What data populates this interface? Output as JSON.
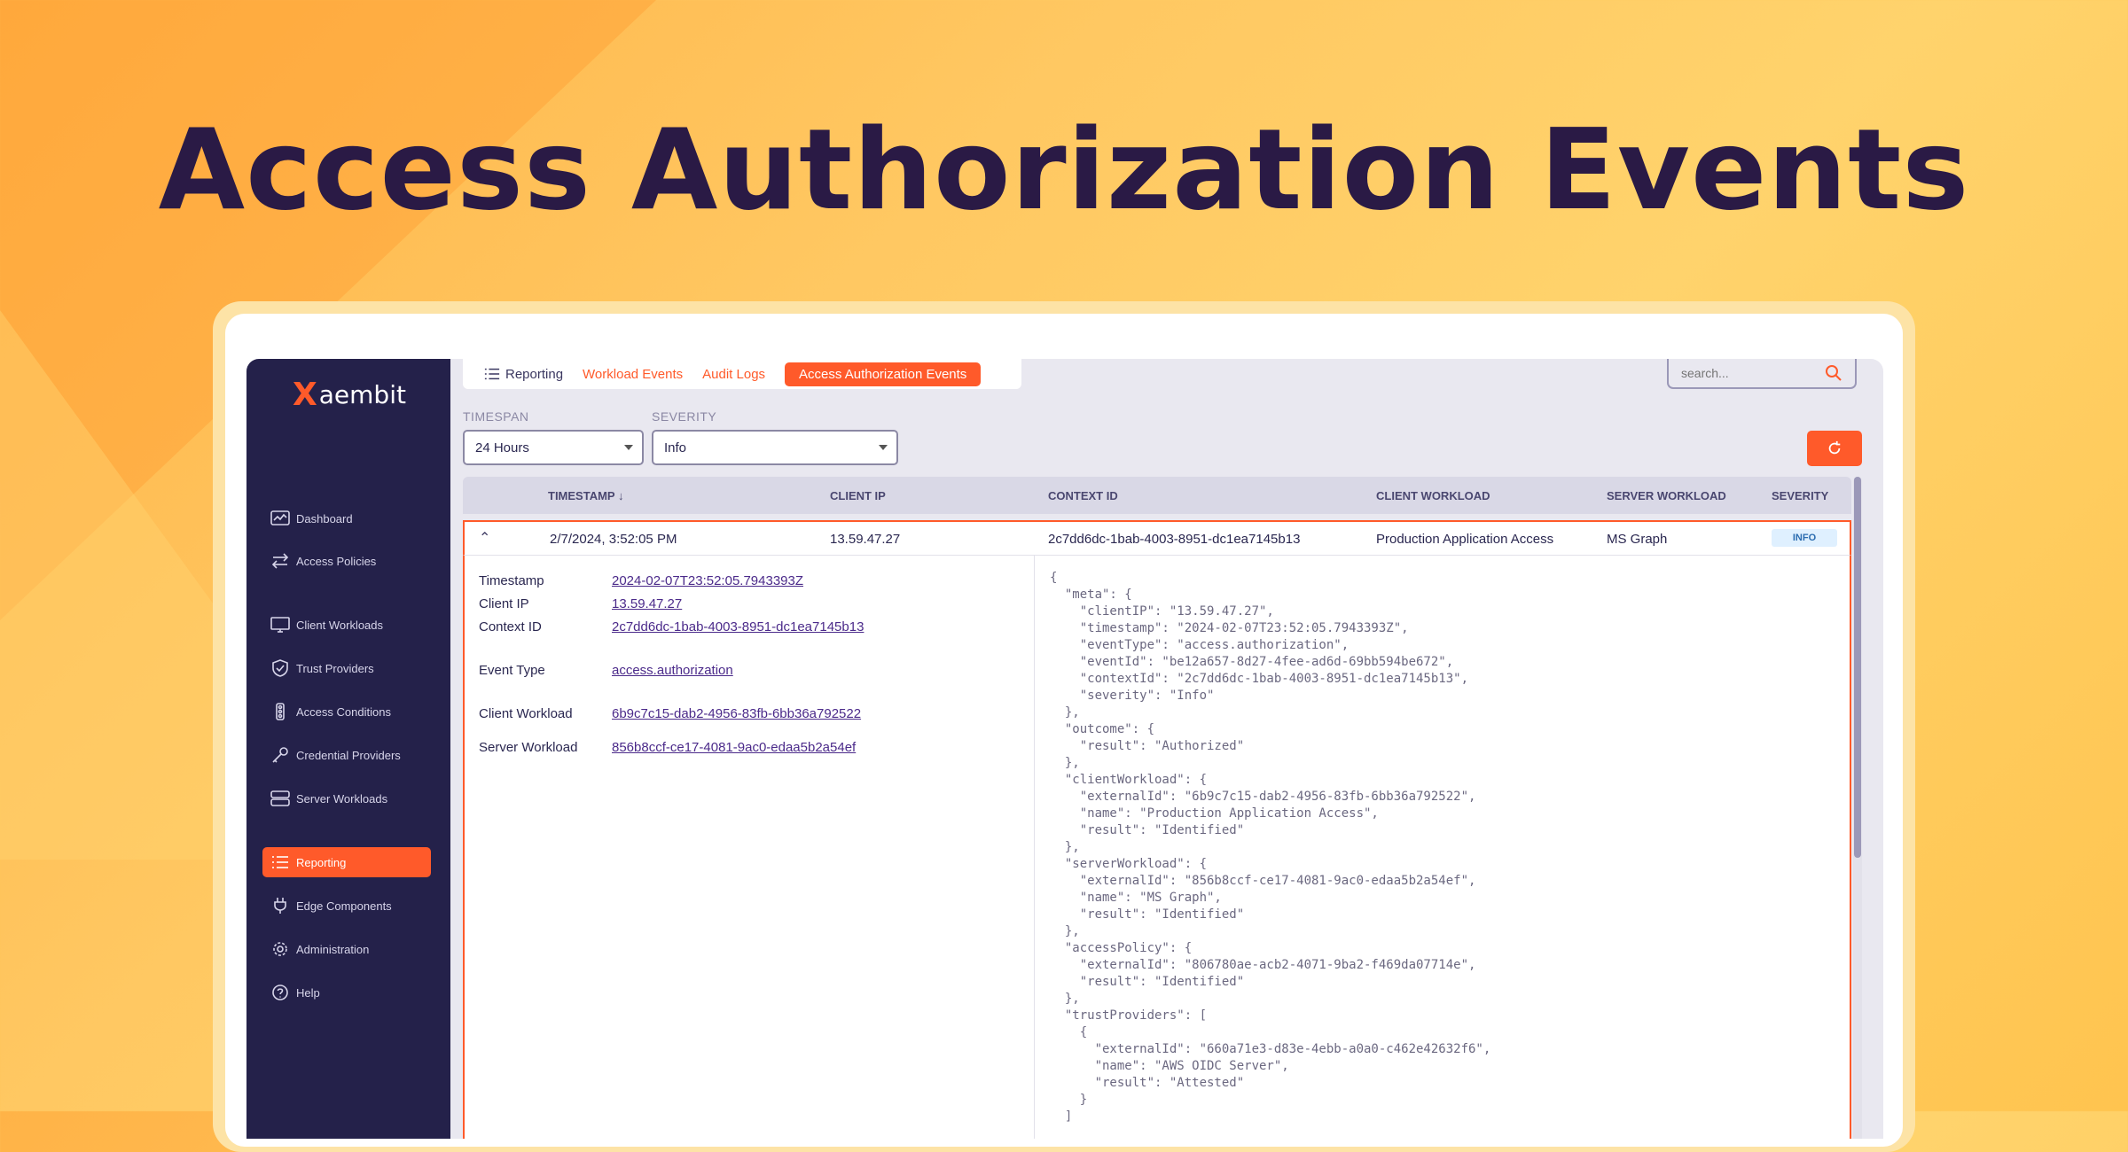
{
  "headline": "Access Authorization Events",
  "brand": {
    "mark": "X",
    "name": "aembit",
    "accent": "#ff5a2a",
    "sidebar_bg": "#24214a"
  },
  "sidebar": {
    "items": [
      {
        "label": "Dashboard",
        "icon": "dashboard-icon"
      },
      {
        "label": "Access Policies",
        "icon": "arrows-exchange-icon"
      },
      {
        "label": "Client Workloads",
        "icon": "monitor-icon"
      },
      {
        "label": "Trust Providers",
        "icon": "shield-check-icon"
      },
      {
        "label": "Access Conditions",
        "icon": "traffic-light-icon"
      },
      {
        "label": "Credential Providers",
        "icon": "key-icon"
      },
      {
        "label": "Server Workloads",
        "icon": "server-icon"
      },
      {
        "label": "Reporting",
        "icon": "list-icon",
        "active": true
      },
      {
        "label": "Edge Components",
        "icon": "plug-icon"
      },
      {
        "label": "Administration",
        "icon": "gear-icon"
      },
      {
        "label": "Help",
        "icon": "help-circle-icon"
      }
    ]
  },
  "tabs": {
    "crumb": "Reporting",
    "items": [
      "Workload Events",
      "Audit Logs",
      "Access Authorization Events"
    ],
    "active": "Access Authorization Events"
  },
  "search": {
    "placeholder": "search..."
  },
  "filters": {
    "timespan": {
      "label": "TIMESPAN",
      "value": "24 Hours"
    },
    "severity": {
      "label": "SEVERITY",
      "value": "Info"
    }
  },
  "table": {
    "columns": [
      "TIMESTAMP",
      "CLIENT IP",
      "CONTEXT ID",
      "CLIENT WORKLOAD",
      "SERVER WORKLOAD",
      "SEVERITY"
    ],
    "sort_indicator": "↓",
    "row": {
      "timestamp": "2/7/2024, 3:52:05 PM",
      "client_ip": "13.59.47.27",
      "context_id": "2c7dd6dc-1bab-4003-8951-dc1ea7145b13",
      "client_workload": "Production Application Access",
      "server_workload": "MS Graph",
      "severity": "INFO"
    }
  },
  "details": {
    "timestamp": {
      "label": "Timestamp",
      "value": "2024-02-07T23:52:05.7943393Z"
    },
    "client_ip": {
      "label": "Client IP",
      "value": "13.59.47.27"
    },
    "context_id": {
      "label": "Context ID",
      "value": "2c7dd6dc-1bab-4003-8951-dc1ea7145b13"
    },
    "event_type": {
      "label": "Event Type",
      "value": "access.authorization"
    },
    "client_workload": {
      "label": "Client Workload",
      "value": "6b9c7c15-dab2-4956-83fb-6bb36a792522"
    },
    "server_workload": {
      "label": "Server Workload",
      "value": "856b8ccf-ce17-4081-9ac0-edaa5b2a54ef"
    }
  },
  "json_text": "{\n  \"meta\": {\n    \"clientIP\": \"13.59.47.27\",\n    \"timestamp\": \"2024-02-07T23:52:05.7943393Z\",\n    \"eventType\": \"access.authorization\",\n    \"eventId\": \"be12a657-8d27-4fee-ad6d-69bb594be672\",\n    \"contextId\": \"2c7dd6dc-1bab-4003-8951-dc1ea7145b13\",\n    \"severity\": \"Info\"\n  },\n  \"outcome\": {\n    \"result\": \"Authorized\"\n  },\n  \"clientWorkload\": {\n    \"externalId\": \"6b9c7c15-dab2-4956-83fb-6bb36a792522\",\n    \"name\": \"Production Application Access\",\n    \"result\": \"Identified\"\n  },\n  \"serverWorkload\": {\n    \"externalId\": \"856b8ccf-ce17-4081-9ac0-edaa5b2a54ef\",\n    \"name\": \"MS Graph\",\n    \"result\": \"Identified\"\n  },\n  \"accessPolicy\": {\n    \"externalId\": \"806780ae-acb2-4071-9ba2-f469da07714e\",\n    \"result\": \"Identified\"\n  },\n  \"trustProviders\": [\n    {\n      \"externalId\": \"660a71e3-d83e-4ebb-a0a0-c462e42632f6\",\n      \"name\": \"AWS OIDC Server\",\n      \"result\": \"Attested\"\n    }\n  ]"
}
